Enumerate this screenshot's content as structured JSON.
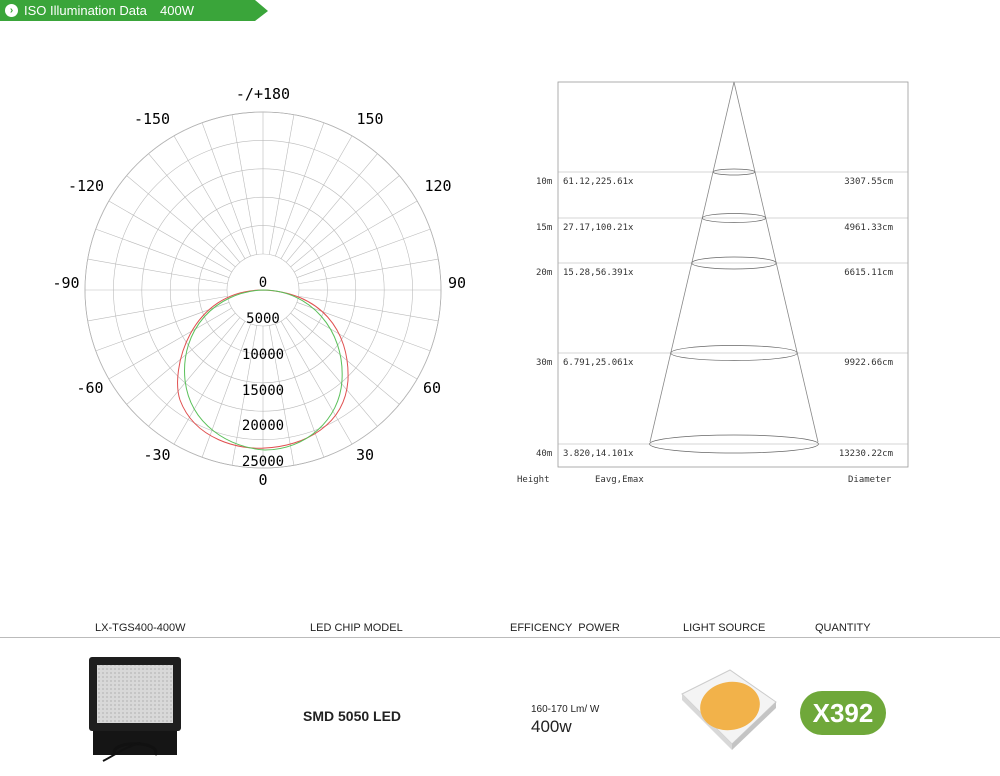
{
  "header": {
    "badge_icon": "chevron-right-icon",
    "title": "ISO Illumination Data",
    "power": "400W",
    "color": "#3aa53a"
  },
  "polar": {
    "top_label": "-/+180",
    "bottom_label": "0",
    "angles": {
      "a150": "150",
      "an150": "-150",
      "a120": "120",
      "an120": "-120",
      "a90": "90",
      "an90": "-90",
      "a60": "60",
      "an60": "-60",
      "a30": "30",
      "an30": "-30"
    },
    "radial": [
      "0",
      "5000",
      "10000",
      "15000",
      "20000",
      "25000"
    ],
    "curve_colors": [
      "#e05050",
      "#5ac05a"
    ]
  },
  "cone": {
    "rows": [
      {
        "height": "10m",
        "eavg_emax": "61.12,225.61x",
        "diameter": "3307.55cm"
      },
      {
        "height": "15m",
        "eavg_emax": "27.17,100.21x",
        "diameter": "4961.33cm"
      },
      {
        "height": "20m",
        "eavg_emax": "15.28,56.391x",
        "diameter": "6615.11cm"
      },
      {
        "height": "30m",
        "eavg_emax": "6.791,25.061x",
        "diameter": "9922.66cm"
      },
      {
        "height": "40m",
        "eavg_emax": "3.820,14.101x",
        "diameter": "13230.22cm"
      }
    ],
    "col_height": "Height",
    "col_eavg": "Eavg,Emax",
    "col_diameter": "Diameter"
  },
  "spec": {
    "model": "LX-TGS400-400W",
    "chip_label": "LED CHIP MODEL",
    "efficiency_label": "EFFICENCY  POWER",
    "source_label": "LIGHT SOURCE",
    "quantity_label": "QUANTITY",
    "chip_model": "SMD 5050 LED",
    "efficiency": "160-170 Lm/ W",
    "power": "400w",
    "quantity": "X392",
    "quantity_color": "#6fa83a"
  }
}
